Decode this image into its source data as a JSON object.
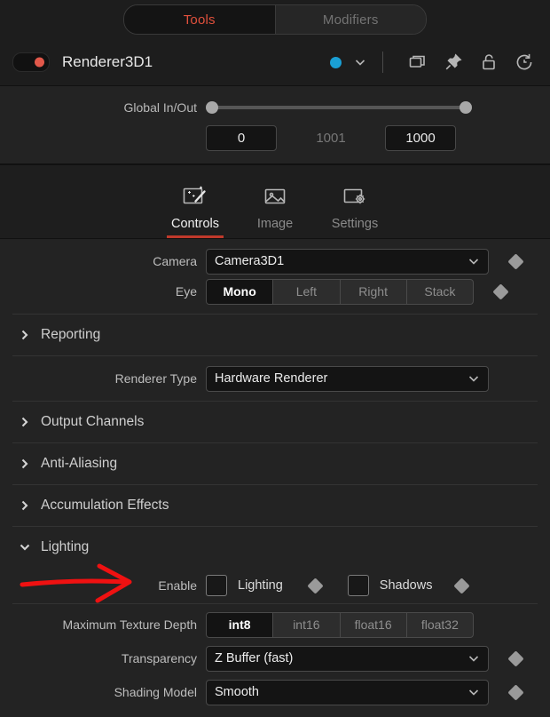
{
  "top_tabs": {
    "tools_label": "Tools",
    "modifiers_label": "Modifiers",
    "active": "Tools",
    "active_color": "#e0503c"
  },
  "node_header": {
    "name": "Renderer3D1",
    "enable_toggle_state": "off",
    "toggle_dot_color": "#e2584a",
    "color_dot": "#1a9fd4",
    "icons": [
      "color-dot",
      "chevron-down-icon",
      "duplicate-icon",
      "pin-icon",
      "unlock-icon",
      "reset-icon"
    ]
  },
  "global_inout": {
    "label": "Global In/Out",
    "in_value": "0",
    "length_value": "1001",
    "out_value": "1000",
    "slider_min_pos": 0,
    "slider_max_pos": 100
  },
  "tabs": [
    {
      "label": "Controls",
      "icon": "magic-wand-icon",
      "active": true
    },
    {
      "label": "Image",
      "icon": "image-icon",
      "active": false
    },
    {
      "label": "Settings",
      "icon": "settings-image-icon",
      "active": false
    }
  ],
  "controls": {
    "camera": {
      "label": "Camera",
      "value": "Camera3D1",
      "has_keyframe_diamond": true
    },
    "eye": {
      "label": "Eye",
      "options": [
        "Mono",
        "Left",
        "Right",
        "Stack"
      ],
      "selected": "Mono",
      "has_keyframe_diamond": true
    },
    "folders": [
      {
        "name": "Reporting",
        "expanded": false
      },
      {
        "name": "Output Channels",
        "expanded": false
      },
      {
        "name": "Anti-Aliasing",
        "expanded": false
      },
      {
        "name": "Accumulation Effects",
        "expanded": false
      },
      {
        "name": "Lighting",
        "expanded": true
      }
    ],
    "renderer_type": {
      "label": "Renderer Type",
      "value": "Hardware Renderer",
      "has_keyframe_diamond": false
    },
    "lighting_enable": {
      "label": "Enable",
      "checkboxes": [
        {
          "label": "Lighting",
          "checked": false,
          "has_keyframe_diamond": true
        },
        {
          "label": "Shadows",
          "checked": false,
          "has_keyframe_diamond": true
        }
      ]
    },
    "max_texture_depth": {
      "label": "Maximum Texture Depth",
      "options": [
        "int8",
        "int16",
        "float16",
        "float32"
      ],
      "selected": "int8"
    },
    "transparency": {
      "label": "Transparency",
      "value": "Z Buffer (fast)",
      "has_keyframe_diamond": true
    },
    "shading_model": {
      "label": "Shading Model",
      "value": "Smooth",
      "has_keyframe_diamond": true
    }
  },
  "annotation": {
    "type": "arrow",
    "color": "#ef1111",
    "points_at": "Enable"
  }
}
